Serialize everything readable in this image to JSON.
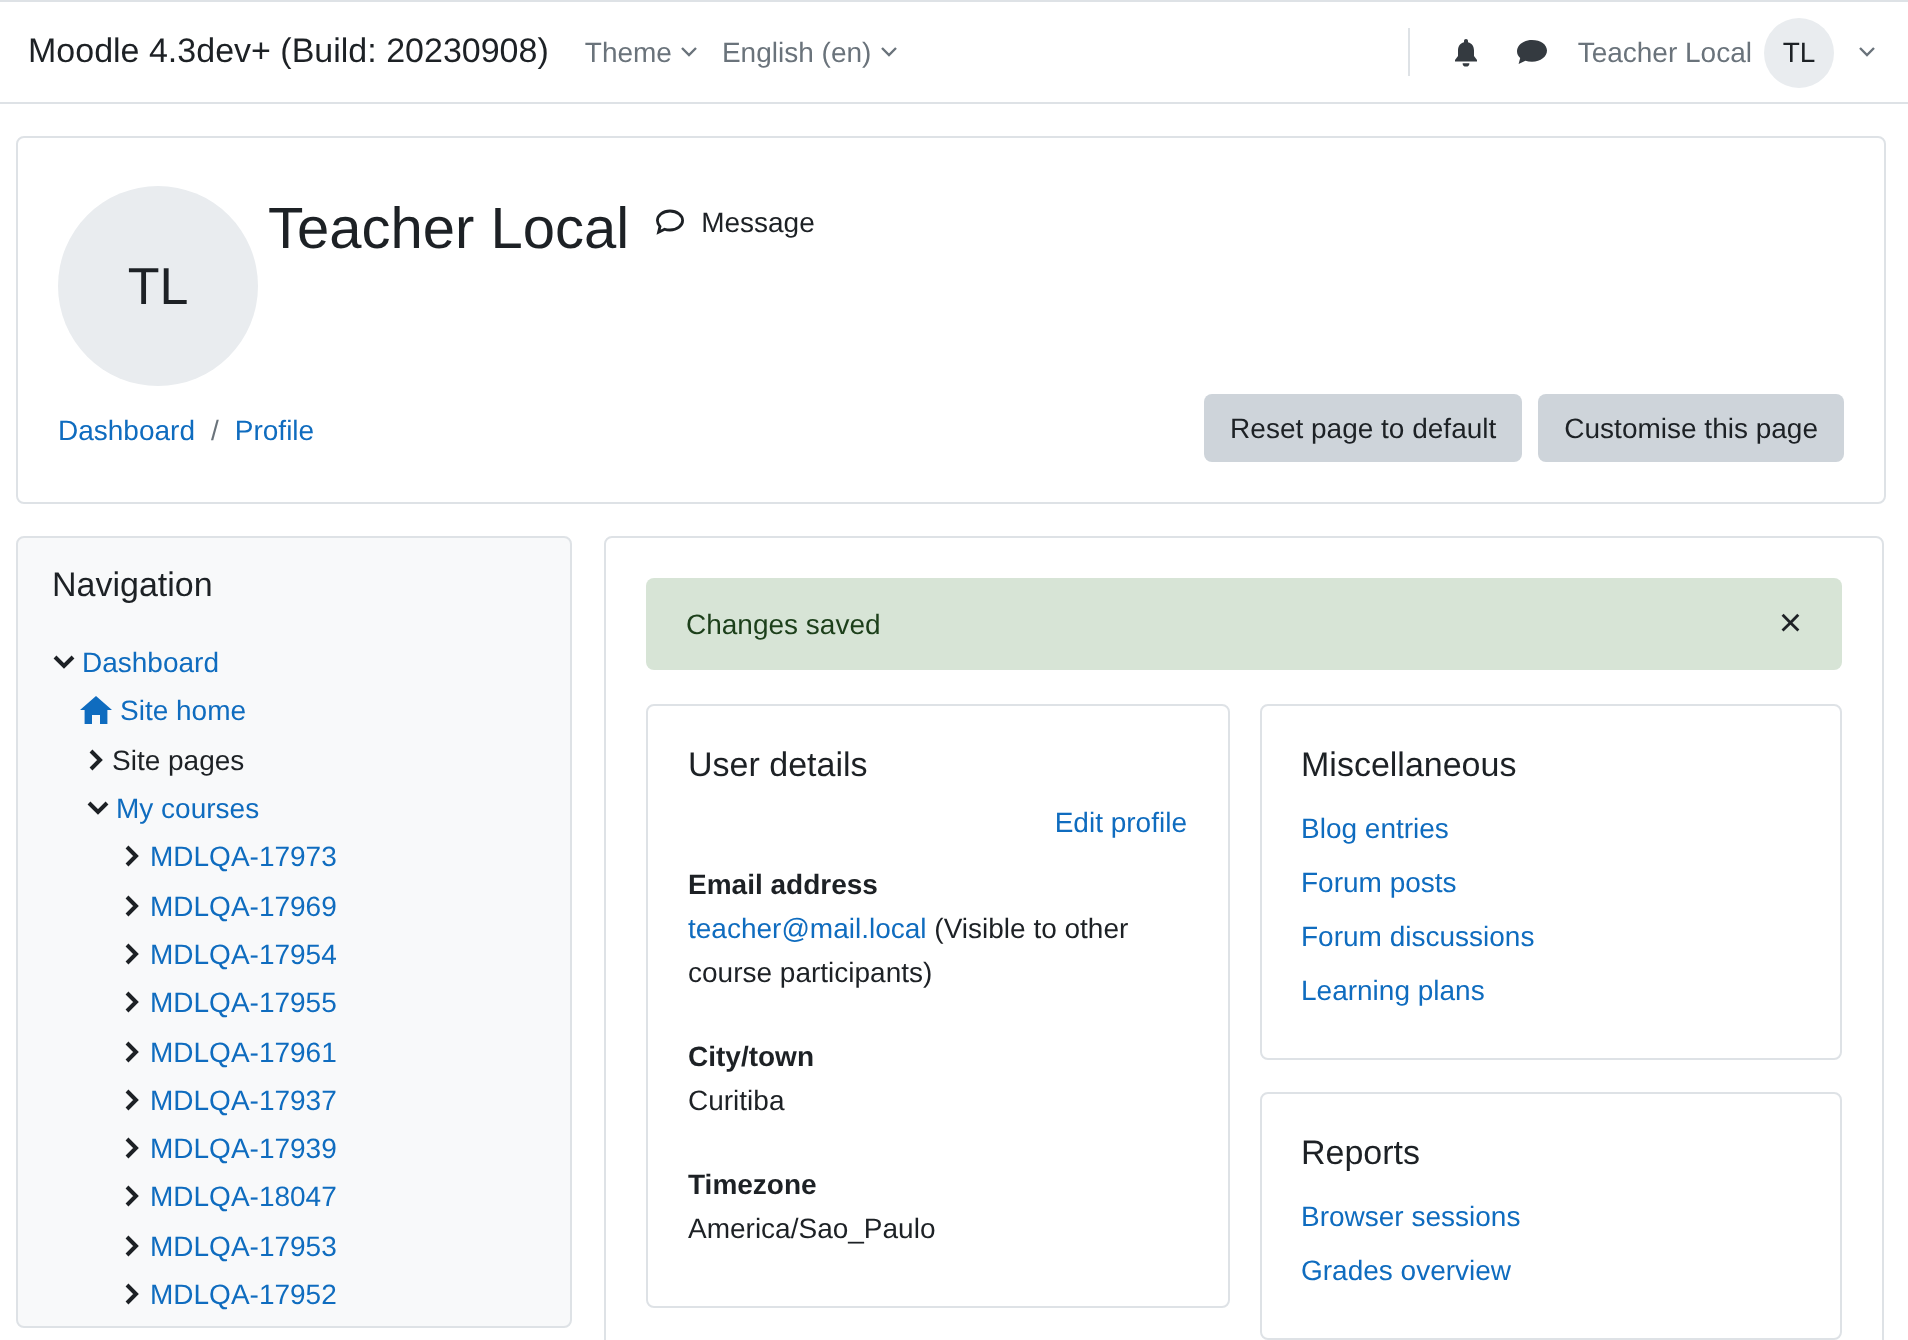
{
  "navbar": {
    "site_name": "Moodle 4.3dev+ (Build: 20230908)",
    "menus": [
      "Theme",
      "English (en)"
    ],
    "user_name": "Teacher Local",
    "user_initials": "TL"
  },
  "profile": {
    "initials": "TL",
    "name": "Teacher Local",
    "message_label": "Message",
    "breadcrumbs": [
      "Dashboard",
      "Profile"
    ],
    "breadcrumb_separator": "/",
    "buttons": [
      "Reset page to default",
      "Customise this page"
    ]
  },
  "navigation": {
    "title": "Navigation",
    "items": [
      {
        "label": "Dashboard",
        "kind": "branch",
        "link": true,
        "expanded": true,
        "children": [
          {
            "label": "Site home",
            "kind": "home",
            "link": true
          },
          {
            "label": "Site pages",
            "kind": "branch",
            "link": false,
            "expanded": false
          },
          {
            "label": "My courses",
            "kind": "branch",
            "link": true,
            "expanded": true,
            "children": [
              {
                "label": "MDLQA-17973",
                "kind": "branch",
                "link": true,
                "expanded": false
              },
              {
                "label": "MDLQA-17969",
                "kind": "branch",
                "link": true,
                "expanded": false
              },
              {
                "label": "MDLQA-17954",
                "kind": "branch",
                "link": true,
                "expanded": false
              },
              {
                "label": "MDLQA-17955",
                "kind": "branch",
                "link": true,
                "expanded": false
              },
              {
                "label": "MDLQA-17961",
                "kind": "branch",
                "link": true,
                "expanded": false
              },
              {
                "label": "MDLQA-17937",
                "kind": "branch",
                "link": true,
                "expanded": false
              },
              {
                "label": "MDLQA-17939",
                "kind": "branch",
                "link": true,
                "expanded": false
              },
              {
                "label": "MDLQA-18047",
                "kind": "branch",
                "link": true,
                "expanded": false
              },
              {
                "label": "MDLQA-17953",
                "kind": "branch",
                "link": true,
                "expanded": false
              },
              {
                "label": "MDLQA-17952",
                "kind": "branch",
                "link": true,
                "expanded": false
              }
            ]
          }
        ]
      }
    ]
  },
  "alert": {
    "text": "Changes saved",
    "close": "×"
  },
  "user_details": {
    "title": "User details",
    "edit_link": "Edit profile",
    "fields": [
      {
        "label": "Email address",
        "link": "teacher@mail.local",
        "value": "(Visible to other course participants)"
      },
      {
        "label": "City/town",
        "value": "Curitiba"
      },
      {
        "label": "Timezone",
        "value": "America/Sao_Paulo"
      }
    ]
  },
  "side_cards": [
    {
      "title": "Miscellaneous",
      "links": [
        "Blog entries",
        "Forum posts",
        "Forum discussions",
        "Learning plans"
      ]
    },
    {
      "title": "Reports",
      "links": [
        "Browser sessions",
        "Grades overview"
      ]
    }
  ]
}
